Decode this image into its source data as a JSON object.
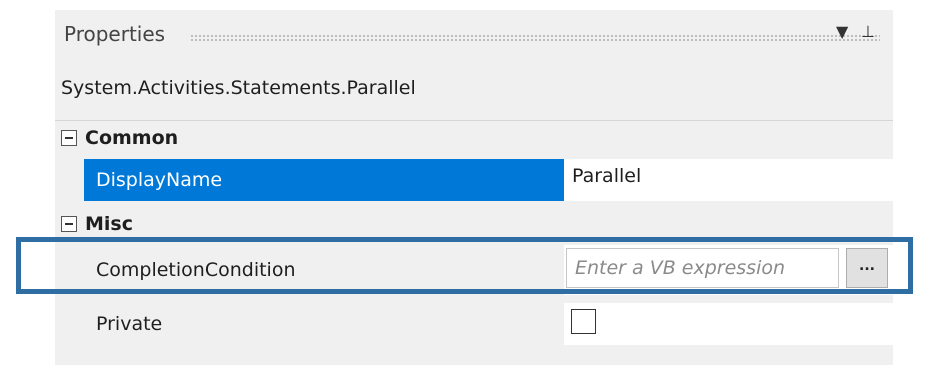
{
  "window": {
    "title": "Properties",
    "dropdown_glyph": "▼",
    "pin_glyph": "⊥"
  },
  "object_type": "System.Activities.Statements.Parallel",
  "categories": [
    {
      "label": "Common",
      "expanded": true,
      "properties": [
        {
          "name": "DisplayName",
          "value": "Parallel",
          "selected": true
        }
      ]
    },
    {
      "label": "Misc",
      "expanded": true,
      "properties": [
        {
          "name": "CompletionCondition",
          "value": "",
          "placeholder": "Enter a VB expression",
          "button_label": "..."
        },
        {
          "name": "Private",
          "checked": false
        }
      ]
    }
  ],
  "colors": {
    "selection": "#0078d7",
    "highlight_box": "#2e6ea3",
    "panel_background": "#f0f0f0"
  }
}
